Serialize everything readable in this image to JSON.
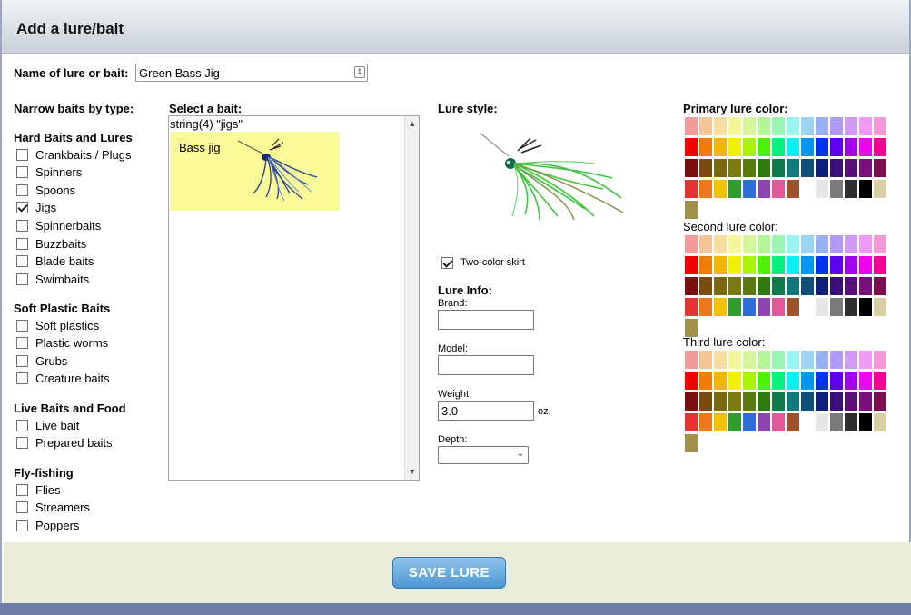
{
  "window": {
    "title": "Add a lure/bait"
  },
  "name_field": {
    "label": "Name of lure or bait:",
    "value": "Green Bass Jig"
  },
  "narrow": {
    "heading": "Narrow baits by type:",
    "groups": [
      {
        "title": "Hard Baits and Lures",
        "items": [
          {
            "label": "Crankbaits / Plugs",
            "checked": false
          },
          {
            "label": "Spinners",
            "checked": false
          },
          {
            "label": "Spoons",
            "checked": false
          },
          {
            "label": "Jigs",
            "checked": true
          },
          {
            "label": "Spinnerbaits",
            "checked": false
          },
          {
            "label": "Buzzbaits",
            "checked": false
          },
          {
            "label": "Blade baits",
            "checked": false
          },
          {
            "label": "Swimbaits",
            "checked": false
          }
        ]
      },
      {
        "title": "Soft Plastic Baits",
        "items": [
          {
            "label": "Soft plastics",
            "checked": false
          },
          {
            "label": "Plastic worms",
            "checked": false
          },
          {
            "label": "Grubs",
            "checked": false
          },
          {
            "label": "Creature baits",
            "checked": false
          }
        ]
      },
      {
        "title": "Live Baits and Food",
        "items": [
          {
            "label": "Live bait",
            "checked": false
          },
          {
            "label": "Prepared baits",
            "checked": false
          }
        ]
      },
      {
        "title": "Fly-fishing",
        "items": [
          {
            "label": "Flies",
            "checked": false
          },
          {
            "label": "Streamers",
            "checked": false
          },
          {
            "label": "Poppers",
            "checked": false
          }
        ]
      }
    ]
  },
  "select_bait": {
    "heading": "Select a bait:",
    "debug_text": "string(4) \"jigs\"",
    "items": [
      {
        "label": "Bass jig",
        "selected": true
      }
    ]
  },
  "lure_style": {
    "heading": "Lure style:",
    "two_color_skirt": {
      "label": "Two-color skirt",
      "checked": true
    }
  },
  "lure_info": {
    "heading": "Lure Info:",
    "brand": {
      "label": "Brand:",
      "value": ""
    },
    "model": {
      "label": "Model:",
      "value": ""
    },
    "weight": {
      "label": "Weight:",
      "value": "3.0",
      "unit": "oz."
    },
    "depth": {
      "label": "Depth:",
      "value": ""
    }
  },
  "colors": {
    "primary_heading": "Primary lure color:",
    "second_heading": "Second lure color:",
    "third_heading": "Third lure color:",
    "palette": [
      [
        "#f39a9a",
        "#f5c59a",
        "#f7dd9f",
        "#f5f59a",
        "#d6f59a",
        "#b5f59a",
        "#9af5b5",
        "#9af5f0",
        "#9ad5f5",
        "#9ab0f5",
        "#b09af5",
        "#d09af5",
        "#f09af5",
        "#f59ad8"
      ],
      [
        "#f20000",
        "#f27d00",
        "#f2b600",
        "#f2f200",
        "#a9f200",
        "#4cf200",
        "#00f27d",
        "#00f2f2",
        "#0096f2",
        "#0033f2",
        "#5d00f2",
        "#a400f2",
        "#f200f2",
        "#f20096"
      ],
      [
        "#7a0f0f",
        "#7a4a0f",
        "#7a6a0f",
        "#7a7a0f",
        "#5a7a0f",
        "#2f7a0f",
        "#0f7a4a",
        "#0f7a7a",
        "#0f4f7a",
        "#0f1f7a",
        "#3a0f7a",
        "#5a0f7a",
        "#7a0f7a",
        "#7a0f4f"
      ],
      [
        "#e53232",
        "#f07a1a",
        "#f2c200",
        "#2f9e2f",
        "#2b6fd6",
        "#8e44ad",
        "#e05a9a",
        "#a0522d",
        "#ffffff",
        "#e6e6e6",
        "#7a7a7a",
        "#2e2e2e",
        "#000000",
        "#d8cfa2",
        "#a0904a"
      ]
    ]
  },
  "footer": {
    "save_label": "SAVE LURE"
  }
}
